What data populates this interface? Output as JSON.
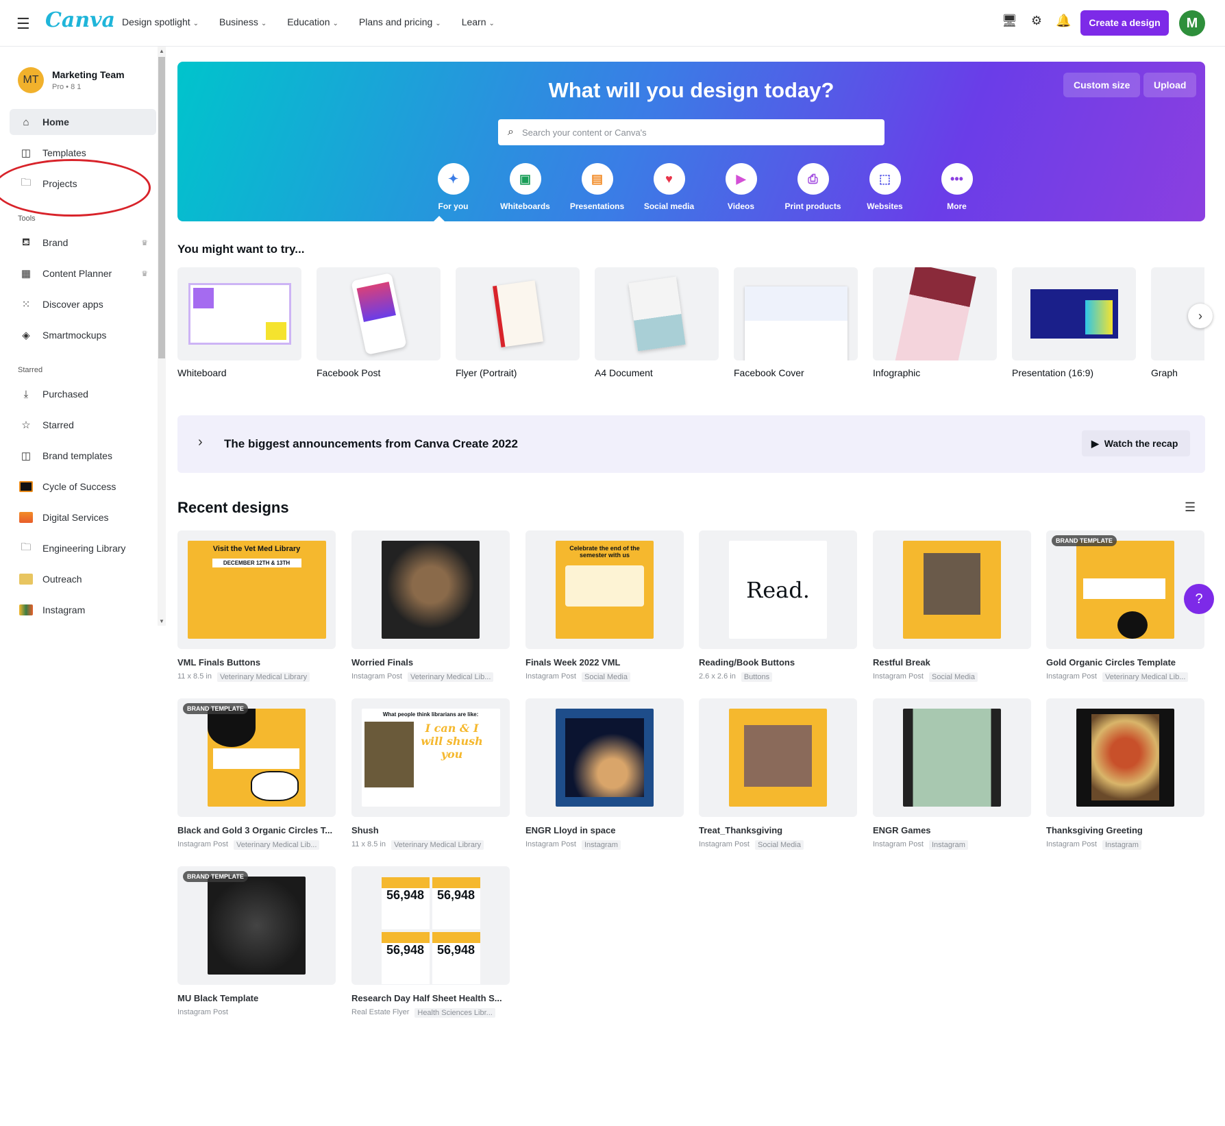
{
  "topbar": {
    "logo": "Canva",
    "nav": [
      "Design spotlight",
      "Business",
      "Education",
      "Plans and pricing",
      "Learn"
    ],
    "create_label": "Create a design",
    "avatar_initial": "M"
  },
  "sidebar": {
    "team_initials": "MT",
    "team_name": "Marketing Team",
    "team_sub": "Pro • 8 1",
    "items": [
      {
        "label": "Home"
      },
      {
        "label": "Templates"
      },
      {
        "label": "Projects"
      }
    ],
    "tools_head": "Tools",
    "tools": [
      {
        "label": "Brand"
      },
      {
        "label": "Content Planner"
      },
      {
        "label": "Discover apps"
      },
      {
        "label": "Smartmockups"
      }
    ],
    "starred_head": "Starred",
    "starred": [
      {
        "label": "Purchased"
      },
      {
        "label": "Starred"
      },
      {
        "label": "Brand templates"
      },
      {
        "label": "Cycle of Success"
      },
      {
        "label": "Digital Services"
      },
      {
        "label": "Engineering Library"
      },
      {
        "label": "Outreach"
      },
      {
        "label": "Instagram"
      }
    ]
  },
  "hero": {
    "title": "What will you design today?",
    "custom_size": "Custom size",
    "upload": "Upload",
    "search_placeholder": "Search your content or Canva's",
    "categories": [
      "For you",
      "Whiteboards",
      "Presentations",
      "Social media",
      "Videos",
      "Print products",
      "Websites",
      "More"
    ]
  },
  "try": {
    "heading": "You might want to try...",
    "items": [
      "Whiteboard",
      "Facebook Post",
      "Flyer (Portrait)",
      "A4 Document",
      "Facebook Cover",
      "Infographic",
      "Presentation (16:9)",
      "Graph"
    ]
  },
  "announce": {
    "text": "The biggest announcements from Canva Create 2022",
    "watch": "Watch the recap"
  },
  "recent": {
    "heading": "Recent designs",
    "badge": "BRAND TEMPLATE",
    "designs": [
      {
        "title": "VML Finals Buttons",
        "type": "11 x 8.5 in",
        "folder": "Veterinary Medical Library"
      },
      {
        "title": "Worried Finals",
        "type": "Instagram Post",
        "folder": "Veterinary Medical Lib..."
      },
      {
        "title": "Finals Week 2022 VML",
        "type": "Instagram Post",
        "folder": "Social Media"
      },
      {
        "title": "Reading/Book Buttons",
        "type": "2.6 x 2.6 in",
        "folder": "Buttons"
      },
      {
        "title": "Restful Break",
        "type": "Instagram Post",
        "folder": "Social Media"
      },
      {
        "title": "Gold Organic Circles Template",
        "type": "Instagram Post",
        "folder": "Veterinary Medical Lib..."
      },
      {
        "title": "Black and Gold 3 Organic Circles T...",
        "type": "Instagram Post",
        "folder": "Veterinary Medical Lib..."
      },
      {
        "title": "Shush",
        "type": "11 x 8.5 in",
        "folder": "Veterinary Medical Library"
      },
      {
        "title": "ENGR Lloyd in space",
        "type": "Instagram Post",
        "folder": "Instagram"
      },
      {
        "title": "Treat_Thanksgiving",
        "type": "Instagram Post",
        "folder": "Social Media"
      },
      {
        "title": "ENGR Games",
        "type": "Instagram Post",
        "folder": "Instagram"
      },
      {
        "title": "Thanksgiving Greeting",
        "type": "Instagram Post",
        "folder": "Instagram"
      },
      {
        "title": "MU Black Template",
        "type": "Instagram Post",
        "folder": ""
      },
      {
        "title": "Research Day Half Sheet Health S...",
        "type": "Real Estate Flyer",
        "folder": "Health Sciences Libr..."
      }
    ],
    "thumb_texts": {
      "read": "Read.",
      "shush_head": "What people think librarians are like:",
      "shush_body": "I can & I will shush you",
      "vml_head": "Visit the Vet Med Library",
      "vml_date": "DECEMBER 12TH & 13TH",
      "finals_head": "Celebrate the end of the semester with us",
      "stat": "56,948"
    }
  },
  "colors": {
    "accent": "#7d2ae8",
    "hero_start": "#00c4cc",
    "hero_end": "#8b3fe0"
  }
}
